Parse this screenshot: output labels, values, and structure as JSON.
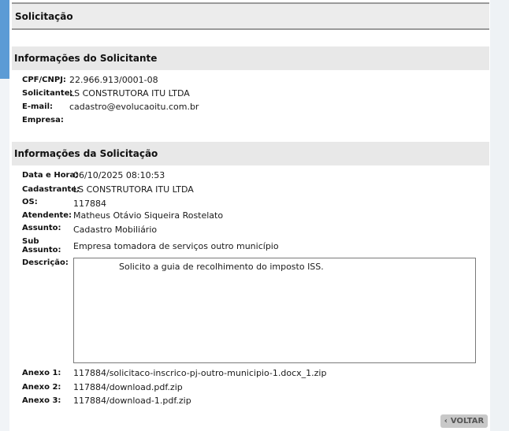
{
  "header": {
    "title": "Solicitação"
  },
  "requester": {
    "section_title": "Informações do Solicitante",
    "fields": [
      {
        "label": "CPF/CNPJ:",
        "value": "22.966.913/0001-08"
      },
      {
        "label": "Solicitante:",
        "value": "LS CONSTRUTORA ITU LTDA"
      },
      {
        "label": "E-mail:",
        "value": "cadastro@evolucaoitu.com.br"
      },
      {
        "label": "Empresa:",
        "value": ""
      }
    ]
  },
  "request": {
    "section_title": "Informações da Solicitação",
    "fields": [
      {
        "label": "Data e Hora:",
        "value": "06/10/2025 08:10:53"
      },
      {
        "label": "Cadastrante:",
        "value": "LS CONSTRUTORA ITU LTDA"
      },
      {
        "label": "OS:",
        "value": "117884"
      },
      {
        "label": "Atendente:",
        "value": "Matheus Otávio Siqueira Rostelato"
      },
      {
        "label": "Assunto:",
        "value": "Cadastro Mobiliário"
      },
      {
        "label_line1": "Sub",
        "label_line2": "Assunto:",
        "value": "Empresa tomadora de serviços outro município"
      }
    ],
    "description_label": "Descrição:",
    "description_text": "Solicito a guia de recolhimento do imposto ISS.",
    "attachments": [
      {
        "label": "Anexo 1:",
        "value": "117884/solicitaco-inscrico-pj-outro-municipio-1.docx_1.zip"
      },
      {
        "label": "Anexo 2:",
        "value": "117884/download.pdf.zip"
      },
      {
        "label": "Anexo 3:",
        "value": "117884/download-1.pdf.zip"
      }
    ]
  },
  "actions": {
    "back_label": "VOLTAR",
    "back_icon": "chevron-left-icon"
  }
}
